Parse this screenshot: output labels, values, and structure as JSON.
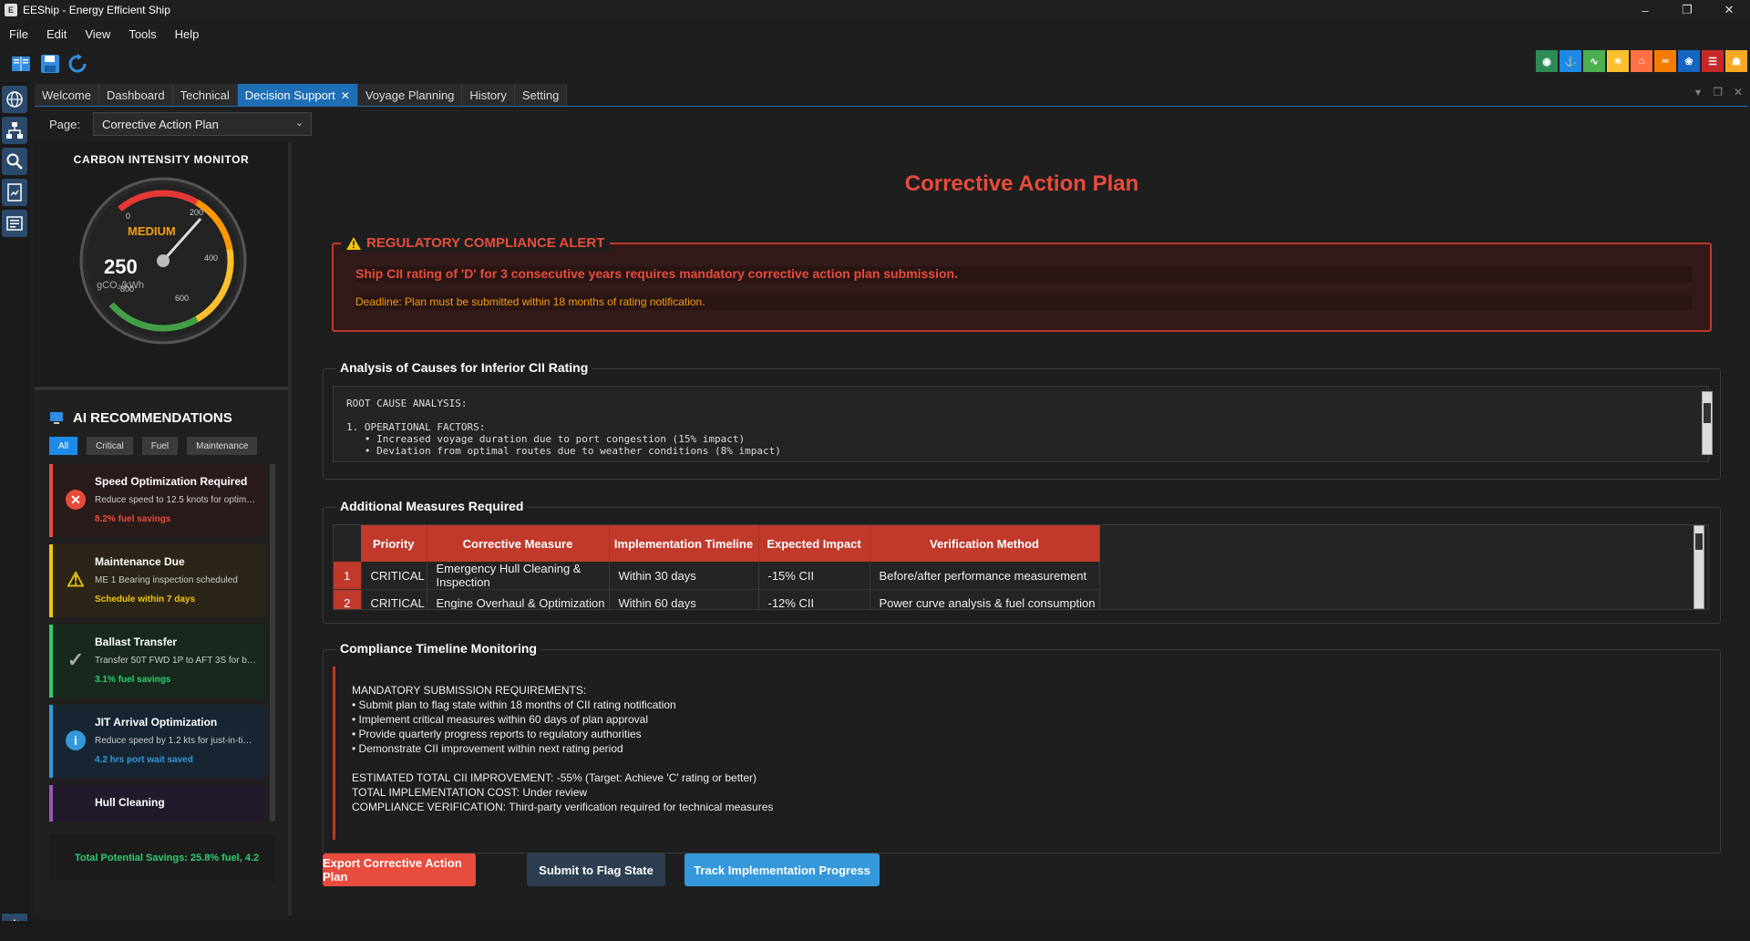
{
  "window": {
    "title": "EEShip - Energy Efficient Ship"
  },
  "menu": [
    "File",
    "Edit",
    "View",
    "Tools",
    "Help"
  ],
  "tabs": [
    {
      "label": "Welcome"
    },
    {
      "label": "Dashboard"
    },
    {
      "label": "Technical"
    },
    {
      "label": "Decision Support",
      "active": true
    },
    {
      "label": "Voyage Planning"
    },
    {
      "label": "History"
    },
    {
      "label": "Setting"
    }
  ],
  "page_selector": {
    "label": "Page:",
    "value": "Corrective Action Plan"
  },
  "monitor": {
    "title": "CARBON INTENSITY MONITOR",
    "level": "MEDIUM",
    "value": "250",
    "unit": "gCO₂/kWh",
    "scale_labels": [
      "0",
      "200",
      "400",
      "600",
      "800"
    ],
    "colors": {
      "red": "#e53935",
      "orange": "#ff9800",
      "yellow": "#fbc02d",
      "green": "#43a047"
    }
  },
  "ai": {
    "title": "AI RECOMMENDATIONS",
    "filters": [
      "All",
      "Critical",
      "Fuel",
      "Maintenance"
    ],
    "cards": [
      {
        "title": "Speed Optimization Required",
        "desc": "Reduce speed to 12.5 knots for optimal ...",
        "saving": "8.2% fuel savings",
        "color": "#e74c3c",
        "bg": "#2a1b1b",
        "icon": "✕"
      },
      {
        "title": "Maintenance Due",
        "desc": "ME 1 Bearing inspection scheduled",
        "saving": "Schedule within 7 days",
        "color": "#f1c40f",
        "bg": "#2a2516",
        "icon": "!"
      },
      {
        "title": "Ballast Transfer",
        "desc": "Transfer 50T FWD 1P to AFT 3S for bette...",
        "saving": "3.1% fuel savings",
        "color": "#2ecc71",
        "bg": "#17291c",
        "icon": "✓"
      },
      {
        "title": "JIT Arrival Optimization",
        "desc": "Reduce speed by 1.2 kts for just-in-time...",
        "saving": "4.2 hrs port wait saved",
        "color": "#3498db",
        "bg": "#172532",
        "icon": "i"
      },
      {
        "title": "Hull Cleaning",
        "desc": "",
        "saving": "",
        "color": "#9b59b6",
        "bg": "#221a2a",
        "icon": ""
      }
    ],
    "total": "Total Potential Savings: 25.8% fuel, 4.2"
  },
  "main": {
    "title": "Corrective Action Plan",
    "alert": {
      "legend": "REGULATORY COMPLIANCE ALERT",
      "line1": "Ship CII rating of 'D' for 3 consecutive years requires mandatory corrective action plan submission.",
      "line2": "Deadline: Plan must be submitted within 18 months of rating notification."
    },
    "analysis": {
      "title": "Analysis of Causes for Inferior CII Rating",
      "text": "ROOT CAUSE ANALYSIS:\n\n1. OPERATIONAL FACTORS:\n   • Increased voyage duration due to port congestion (15% impact)\n   • Deviation from optimal routes due to weather conditions (8% impact)"
    },
    "measures": {
      "title": "Additional Measures Required",
      "headers": [
        "Priority",
        "Corrective Measure",
        "Implementation Timeline",
        "Expected Impact",
        "Verification Method"
      ],
      "rows": [
        {
          "n": "1",
          "cells": [
            "CRITICAL",
            "Emergency Hull Cleaning & Inspection",
            "Within 30 days",
            "-15% CII",
            "Before/after performance measurement"
          ]
        },
        {
          "n": "2",
          "cells": [
            "CRITICAL",
            "Engine Overhaul & Optimization",
            "Within 60 days",
            "-12% CII",
            "Power curve analysis & fuel consumption"
          ]
        }
      ]
    },
    "timeline": {
      "title": "Compliance Timeline  Monitoring",
      "text": "MANDATORY SUBMISSION REQUIREMENTS:\n• Submit plan to flag state within 18 months of CII rating notification\n• Implement critical measures within 60 days of plan approval\n• Provide quarterly progress reports to regulatory authorities\n• Demonstrate CII improvement within next rating period\n\nESTIMATED TOTAL CII IMPROVEMENT: -55% (Target: Achieve 'C' rating or better)\nTOTAL IMPLEMENTATION COST: Under review\nCOMPLIANCE VERIFICATION: Third-party verification required for technical measures"
    },
    "buttons": {
      "export": "Export Corrective Action Plan",
      "submit": "Submit to Flag State",
      "track": "Track Implementation Progress"
    }
  }
}
